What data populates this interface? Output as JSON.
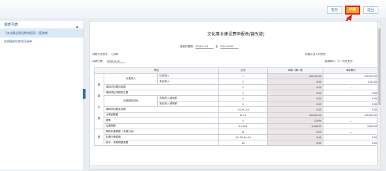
{
  "toolbar": {
    "save": "暂存",
    "report": "申报",
    "back": "返回"
  },
  "sidebar": {
    "title": "报表列表",
    "items": [
      "《文化事业建设费申报表》（营改增）",
      "应税服务扣除项目清单"
    ]
  },
  "form": {
    "title": "文化事业建设费申报表(营改增)",
    "period_label": "费款所属期:",
    "period_start": "2018-04-01",
    "period_to": "至",
    "period_end": "2018-06-30",
    "taxpayer_id_label": "纳税人识别号：（公章）",
    "agent_label": "扣缴义务人识别号：",
    "fill_date_label": "填表日期：",
    "fill_date": "2018.10.12",
    "unit_label": "金额单位：元（列至角分）"
  },
  "table": {
    "headers": [
      "项目",
      "栏次",
      "本期（期）数",
      "本年累计"
    ],
    "rows": [
      [
        "计费收入",
        "应征收入",
        "1",
        "100,001.00",
        "100,001.00"
      ],
      [
        "",
        "免征收入",
        "2",
        "0.00",
        "1,111.00"
      ],
      [
        "减除项目期初金额",
        "",
        "3",
        "0.00",
        "—"
      ],
      [
        "减除项目本期发生额",
        "",
        "4",
        "0.00",
        "0.00"
      ],
      [
        "应税服务扣除",
        "",
        "5",
        "0.00",
        "0.00"
      ],
      [
        "",
        "",
        "6",
        "0.00",
        "0.00"
      ],
      [
        "减除项目期末余额",
        "",
        "7=3+4-5-6",
        "0.00",
        "0.00"
      ],
      [
        "计费销售额",
        "",
        "8=1-5",
        "100,001.00",
        "100,001.00"
      ],
      [
        "费率",
        "",
        "9",
        "3.00%",
        "—"
      ],
      [
        "应缴费额",
        "",
        "10=8*9",
        "3,000.03",
        "3,000.03"
      ],
      [
        "期初未缴费额（多缴为负）",
        "",
        "11",
        "0.00",
        "—"
      ],
      [
        "本期已缴费额",
        "",
        "12=13+14+15",
        "0.00",
        "0.00"
      ],
      [
        "其中：本期预缴费额",
        "",
        "13",
        "0.00",
        "0.00"
      ]
    ],
    "sub_labels": [
      "扣除收入减除额",
      "免征收入减除额"
    ],
    "side_chars": [
      "费",
      "款",
      "计",
      "算",
      "费"
    ]
  }
}
